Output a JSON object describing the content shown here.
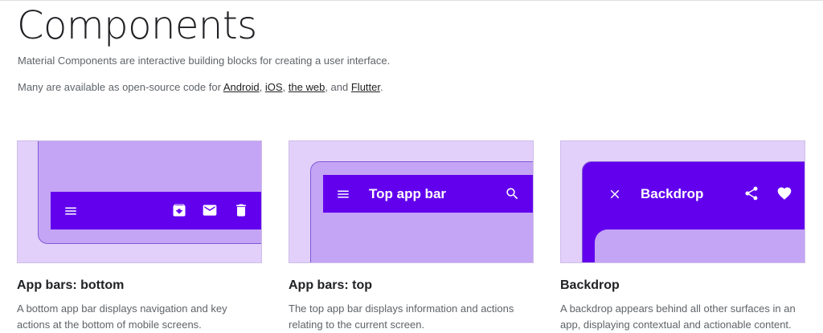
{
  "page": {
    "title": "Components",
    "intro": "Material Components are interactive building blocks for creating a user interface.",
    "availability": {
      "prefix": "Many are available as open-source code for ",
      "links": [
        "Android",
        "iOS",
        "the web",
        "Flutter"
      ],
      "sep1": ", ",
      "sep2": ", ",
      "sep3": ", and ",
      "suffix": "."
    }
  },
  "cards": [
    {
      "title": "App bars: bottom",
      "description": "A bottom app bar displays navigation and key actions at the bottom of mobile screens."
    },
    {
      "title": "App bars: top",
      "bar_label": "Top app bar",
      "description": "The top app bar displays information and actions relating to the current screen."
    },
    {
      "title": "Backdrop",
      "bar_label": "Backdrop",
      "description": "A backdrop appears behind all other surfaces in an app, displaying contextual and actionable content."
    }
  ],
  "icons": {
    "menu": "menu-icon",
    "archive": "archive-icon",
    "mail": "mail-icon",
    "delete": "delete-icon",
    "search": "search-icon",
    "close": "close-icon",
    "share": "share-icon",
    "favorite": "heart-icon"
  },
  "colors": {
    "primary": "#6200ee",
    "thumb_bg": "#e2cffa",
    "surface": "#c4a4f4"
  }
}
